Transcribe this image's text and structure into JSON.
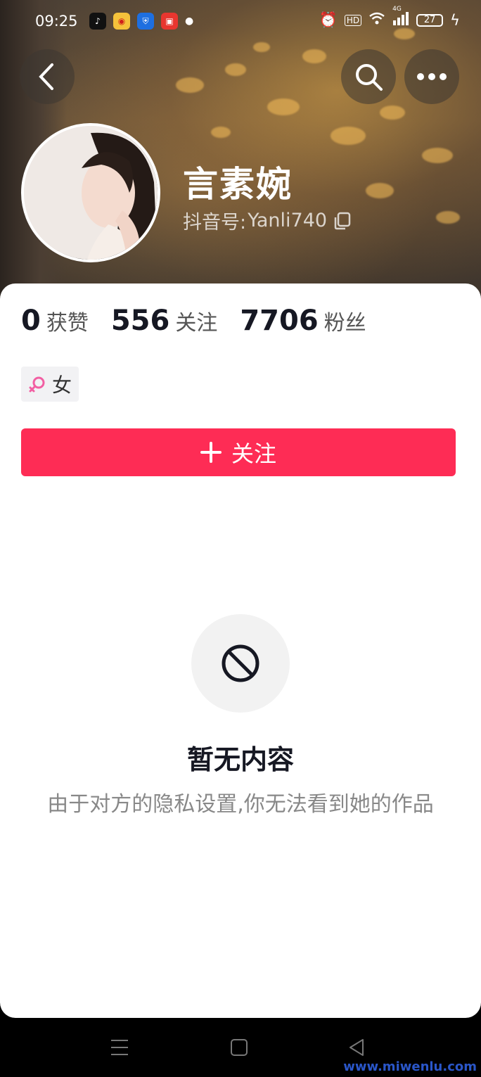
{
  "status_bar": {
    "time": "09:25",
    "battery": "27",
    "network": "4G"
  },
  "profile": {
    "name": "言素婉",
    "id_label": "抖音号:",
    "id_value": "Yanli740",
    "gender": "女"
  },
  "stats": [
    {
      "value": "0",
      "label": "获赞"
    },
    {
      "value": "556",
      "label": "关注"
    },
    {
      "value": "7706",
      "label": "粉丝"
    }
  ],
  "follow_button": {
    "icon": "plus-icon",
    "label": "关注"
  },
  "empty_state": {
    "icon": "block-icon",
    "title": "暂无内容",
    "description": "由于对方的隐私设置,你无法看到她的作品"
  },
  "watermark": "www.miwenlu.com",
  "colors": {
    "accent": "#fe2c55",
    "text_primary": "#161823",
    "text_secondary": "#888888"
  }
}
